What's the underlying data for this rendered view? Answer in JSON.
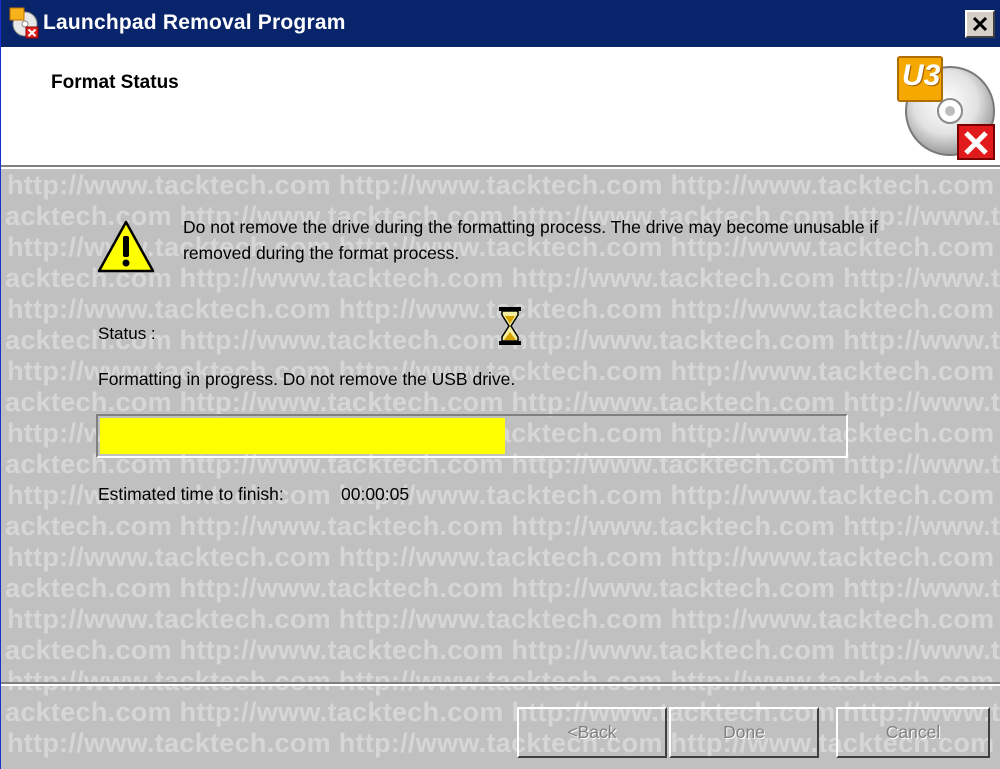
{
  "window": {
    "title": "Launchpad Removal Program"
  },
  "header": {
    "title": "Format Status",
    "logo_text": "U3"
  },
  "warning": {
    "text": "Do not remove the drive during the formatting process. The drive may become unusable if removed during the format process."
  },
  "status": {
    "label": "Status :",
    "message": "Formatting in progress. Do not remove the USB drive.",
    "progress": 0.545,
    "eta_label": "Estimated time to finish:",
    "eta_value": "00:00:05"
  },
  "buttons": {
    "back": "<Back",
    "done": "Done",
    "cancel": "Cancel"
  },
  "watermark": {
    "line_a": "http://www.tacktech.com http://www.tacktech.com http://www.tacktech.com",
    "line_b": "acktech.com http://www.tacktech.com http://www.tacktech.com http://www.t"
  },
  "colors": {
    "titlebar": "#08246b",
    "progress_fill": "#ffff00",
    "dialog_bg": "#c0c0c0"
  }
}
